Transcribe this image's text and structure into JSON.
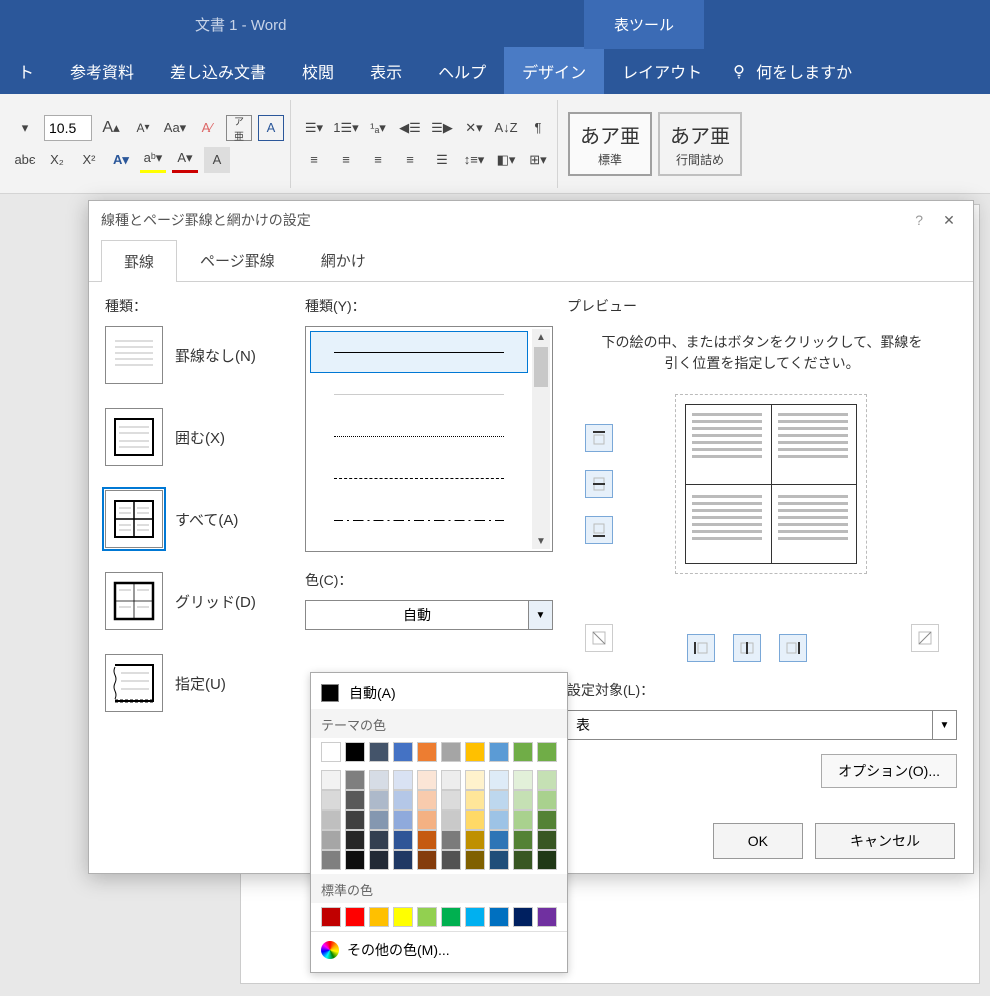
{
  "titleBar": {
    "docTitle": "文書 1 - Word",
    "toolsTitle": "表ツール"
  },
  "ribbonTabs": {
    "items": [
      "ト",
      "参考資料",
      "差し込み文書",
      "校閲",
      "表示",
      "ヘルプ",
      "デザイン",
      "レイアウト"
    ],
    "searchPlaceholder": "何をしますか"
  },
  "toolbar": {
    "fontSize": "10.5",
    "styleBox1": {
      "sample": "あア亜",
      "label": "標準"
    },
    "styleBox2": {
      "sample": "あア亜",
      "label": "行間詰め"
    }
  },
  "dialog": {
    "title": "線種とページ罫線と網かけの設定",
    "tabs": [
      "罫線",
      "ページ罫線",
      "網かけ"
    ],
    "setting": {
      "label": "種類：",
      "items": [
        {
          "label": "罫線なし(N)"
        },
        {
          "label": "囲む(X)"
        },
        {
          "label": "すべて(A)"
        },
        {
          "label": "グリッド(D)"
        },
        {
          "label": "指定(U)"
        }
      ]
    },
    "styleLabel": "種類(Y)：",
    "colorLabel": "色(C)：",
    "colorValue": "自動",
    "previewLabel": "プレビュー",
    "previewInstr": "下の絵の中、またはボタンをクリックして、罫線を引く位置を指定してください。",
    "applyToLabel": "設定対象(L)：",
    "applyToValue": "表",
    "optionsBtn": "オプション(O)...",
    "ok": "OK",
    "cancel": "キャンセル"
  },
  "colorPopup": {
    "auto": "自動(A)",
    "themeLabel": "テーマの色",
    "standardLabel": "標準の色",
    "moreColors": "その他の色(M)...",
    "themeRow1": [
      "#ffffff",
      "#000000",
      "#44546a",
      "#4472c4",
      "#ed7d31",
      "#a5a5a5",
      "#ffc000",
      "#5b9bd5",
      "#70ad47",
      "#70ad47"
    ],
    "themeShades": [
      [
        "#f2f2f2",
        "#7f7f7f",
        "#d6dce5",
        "#d9e2f3",
        "#fbe5d6",
        "#ededed",
        "#fff2cc",
        "#deebf7",
        "#e2f0d9",
        "#c5e0b4"
      ],
      [
        "#d9d9d9",
        "#595959",
        "#adb9ca",
        "#b4c7e7",
        "#f8cbad",
        "#dbdbdb",
        "#ffe699",
        "#bdd7ee",
        "#c5e0b4",
        "#a9d18e"
      ],
      [
        "#bfbfbf",
        "#404040",
        "#8497b0",
        "#8faadc",
        "#f4b183",
        "#c9c9c9",
        "#ffd966",
        "#9dc3e6",
        "#a9d18e",
        "#548235"
      ],
      [
        "#a6a6a6",
        "#262626",
        "#333f50",
        "#2f5597",
        "#c55a11",
        "#7b7b7b",
        "#bf9000",
        "#2e75b6",
        "#548235",
        "#385723"
      ],
      [
        "#808080",
        "#0d0d0d",
        "#222a35",
        "#1f3864",
        "#843c0c",
        "#525252",
        "#806000",
        "#1f4e79",
        "#385723",
        "#203817"
      ]
    ],
    "standard": [
      "#c00000",
      "#ff0000",
      "#ffc000",
      "#ffff00",
      "#92d050",
      "#00b050",
      "#00b0f0",
      "#0070c0",
      "#002060",
      "#7030a0"
    ]
  }
}
